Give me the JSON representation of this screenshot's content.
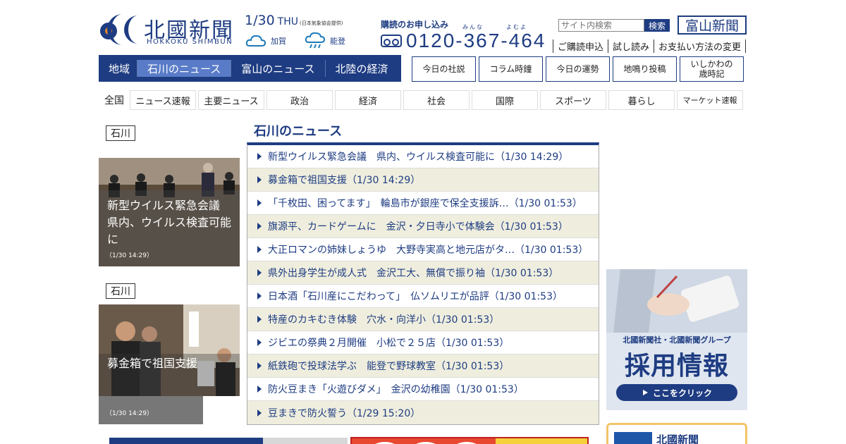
{
  "header": {
    "logo_title": "北國新聞",
    "logo_sub": "HOKKOKU SHIMBUN",
    "date": "1/30",
    "day": "THU",
    "weather_credit": "(日本気象協会提供)",
    "weather": [
      {
        "icon": "cloud-icon",
        "label": "加賀"
      },
      {
        "icon": "rain-icon",
        "label": "能登"
      }
    ],
    "subscribe_heading": "購読のお申し込み",
    "ruby_1": "みんな",
    "ruby_2": "よむよ",
    "phone": "0120-367-464",
    "search_placeholder": "サイト内検索",
    "search_button": "検索",
    "toyama_label": "富山新聞",
    "sub_links": [
      "ご購読申込",
      "試し読み",
      "お支払い方法の変更"
    ]
  },
  "nav": {
    "region_label": "地域",
    "region_tabs": [
      {
        "label": "石川のニュース",
        "active": true
      },
      {
        "label": "富山のニュース",
        "active": false
      },
      {
        "label": "北陸の経済",
        "active": false
      }
    ],
    "columns": [
      "今日の社説",
      "コラム時鐘",
      "今日の運勢",
      "地鳴り投稿",
      "いしかわの\n歳時記"
    ],
    "category_all": "全国",
    "categories": [
      "ニュース速報",
      "主要ニュース",
      "政治",
      "経済",
      "社会",
      "国際",
      "スポーツ",
      "暮らし",
      "マーケット速報"
    ]
  },
  "featured": [
    {
      "tag": "石川",
      "caption": "新型ウイルス緊急会議　県内、ウイルス検査可能に",
      "time": "（1/30 14:29）"
    },
    {
      "tag": "石川",
      "caption": "募金箱で祖国支援",
      "time": "（1/30 14:29）"
    }
  ],
  "news": {
    "title": "石川のニュース",
    "items": [
      "新型ウイルス緊急会議　県内、ウイルス検査可能に（1/30 14:29）",
      "募金箱で祖国支援（1/30 14:29）",
      "「千枚田、困ってます」　輪島市が銀座で保全支援訴…（1/30 01:53）",
      "旗源平、カードゲームに　金沢・夕日寺小で体験会（1/30 01:53）",
      "大正ロマンの姉妹しょうゆ　大野寺実高と地元店がタ…（1/30 01:53）",
      "県外出身学生が成人式　金沢工大、無償で振り袖（1/30 01:53）",
      "日本酒「石川産にこだわって」　仏ソムリエが品評（1/30 01:53）",
      "特産のカキむき体験　穴水・向洋小（1/30 01:53）",
      "ジビエの祭典２月開催　小松で２５店（1/30 01:53）",
      "紙鉄砲で投球法学ぶ　能登で野球教室（1/30 01:53）",
      "防火豆まき「火遊びダメ」　金沢の幼稚園（1/30 01:53）",
      "豆まきで防火誓う（1/29 15:20）"
    ]
  },
  "ads": {
    "recruit_top": "北國新聞社・北國新聞グループ",
    "recruit_main": "採用情報",
    "recruit_button": "ここをクリック",
    "card_title": "北國新聞"
  },
  "colors": {
    "brand": "#1e3c82",
    "active_tab": "#5a7cc8",
    "stripe": "#efeede"
  }
}
